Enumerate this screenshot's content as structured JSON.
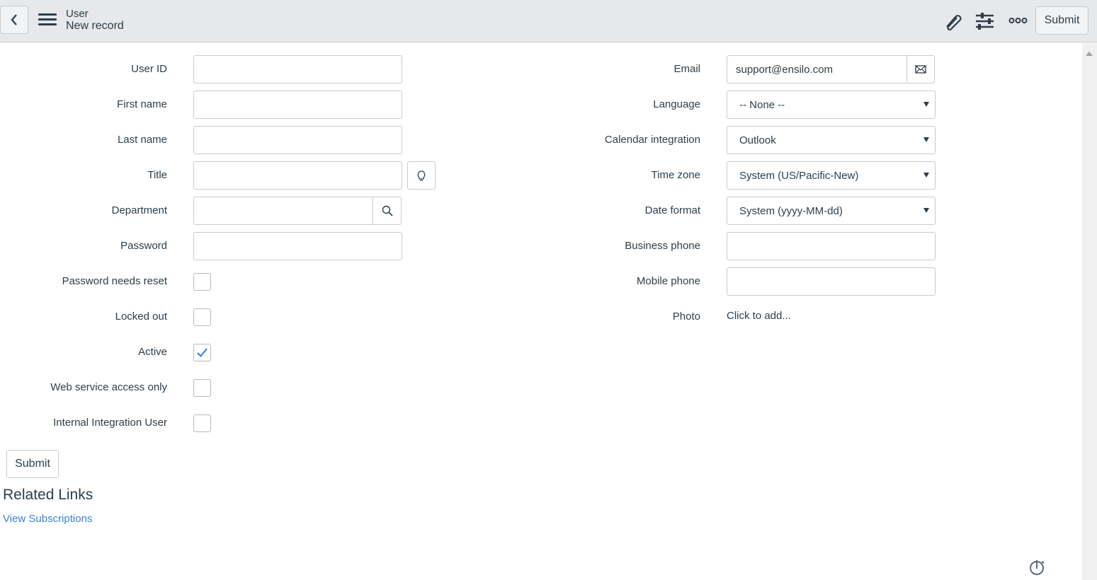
{
  "header": {
    "title": "User",
    "subtitle": "New record",
    "submit_label": "Submit"
  },
  "left_fields": [
    {
      "label": "User ID",
      "value": ""
    },
    {
      "label": "First name",
      "value": ""
    },
    {
      "label": "Last name",
      "value": ""
    },
    {
      "label": "Title",
      "value": ""
    },
    {
      "label": "Department",
      "value": ""
    },
    {
      "label": "Password",
      "value": ""
    }
  ],
  "checkboxes": [
    {
      "label": "Password needs reset",
      "checked": false
    },
    {
      "label": "Locked out",
      "checked": false
    },
    {
      "label": "Active",
      "checked": true
    },
    {
      "label": "Web service access only",
      "checked": false
    },
    {
      "label": "Internal Integration User",
      "checked": false
    }
  ],
  "right_fields": {
    "email": {
      "label": "Email",
      "value": "support@ensilo.com"
    },
    "language": {
      "label": "Language",
      "value": "-- None --"
    },
    "calendar": {
      "label": "Calendar integration",
      "value": "Outlook"
    },
    "timezone": {
      "label": "Time zone",
      "value": "System (US/Pacific-New)"
    },
    "date_format": {
      "label": "Date format",
      "value": "System (yyyy-MM-dd)"
    },
    "business_phone": {
      "label": "Business phone",
      "value": ""
    },
    "mobile_phone": {
      "label": "Mobile phone",
      "value": ""
    },
    "photo": {
      "label": "Photo",
      "value": "Click to add..."
    }
  },
  "footer": {
    "submit_label": "Submit",
    "related_links_title": "Related Links",
    "view_subscriptions": "View Subscriptions"
  },
  "colors": {
    "link": "#3b83d8",
    "check": "#2d7fd8",
    "header_bg": "#e6e8eb"
  }
}
